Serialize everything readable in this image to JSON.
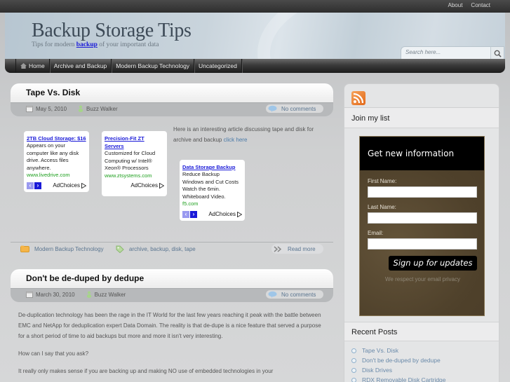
{
  "topbar": {
    "links": [
      "About",
      "Contact"
    ]
  },
  "header": {
    "title": "Backup Storage Tips",
    "tagline_pre": "Tips for modern ",
    "tagline_link": "backup",
    "tagline_post": " of your important data"
  },
  "search": {
    "placeholder": "Search here...",
    "icon": "magnifier-icon"
  },
  "nav": {
    "items": [
      {
        "label": "Home",
        "icon": "home-icon"
      },
      {
        "label": "Archive and Backup"
      },
      {
        "label": "Modern Backup Technology"
      },
      {
        "label": "Uncategorized"
      }
    ]
  },
  "posts": [
    {
      "title": "Tape Vs. Disk",
      "date": "May 5, 2010",
      "author": "Buzz Walker",
      "comments": "No comments",
      "text_pre": "Here is an interesting article discussing tape and disk for archive and backup ",
      "text_link": "click here",
      "category": "Modern Backup Technology",
      "tags": "archive, backup, disk, tape",
      "read_more": "Read more"
    },
    {
      "title": "Don't be de-duped by dedupe",
      "date": "March 30, 2010",
      "author": "Buzz Walker",
      "comments": "No comments",
      "paragraphs": [
        "De-duplication technology has been the rage in the IT World for the last few years reaching it peak with the battle between EMC and NetApp for deduplication expert Data Domain.  The reality is that de-dupe is a nice feature that served a purpose for a short period of time to aid backups but more and more it isn't very interesting.",
        "How can I say that you ask?",
        "It really only makes sense if you are backing up and making NO use of embedded technologies in your"
      ]
    }
  ],
  "ads": [
    {
      "title": "2TB Cloud Storage: $16",
      "body": "Appears on your computer like any disk drive. Access files anywhere.",
      "url": "www.livedrive.com",
      "choices": "AdChoices",
      "has_arrows": true
    },
    {
      "title": "Precision-Fit ZT Servers",
      "body": "Customized for Cloud Computing w/ Intel® Xeon® Processors",
      "url": "www.ztsystems.com",
      "choices": "AdChoices",
      "has_arrows": false
    },
    {
      "title": "Data Storage Backup",
      "body": "Reduce Backup Windows and Cut Costs Watch the 6min. Whiteboard Video.",
      "url": "f5.com",
      "choices": "AdChoices",
      "has_arrows": true
    }
  ],
  "sidebar": {
    "rss_icon": "rss-icon",
    "join_title": "Join my list",
    "optin": {
      "heading": "Get new information",
      "first_name_label": "First Name:",
      "last_name_label": "Last Name:",
      "email_label": "Email:",
      "first_name_value": "",
      "last_name_value": "",
      "email_value": "",
      "button": "Sign up for updates",
      "privacy": "We respect your email privacy"
    },
    "recent_title": "Recent Posts",
    "recent_posts": [
      "Tape Vs. Disk",
      "Don't be de-duped by dedupe",
      "Disk Drives",
      "RDX Removable Disk Cartridge"
    ]
  }
}
